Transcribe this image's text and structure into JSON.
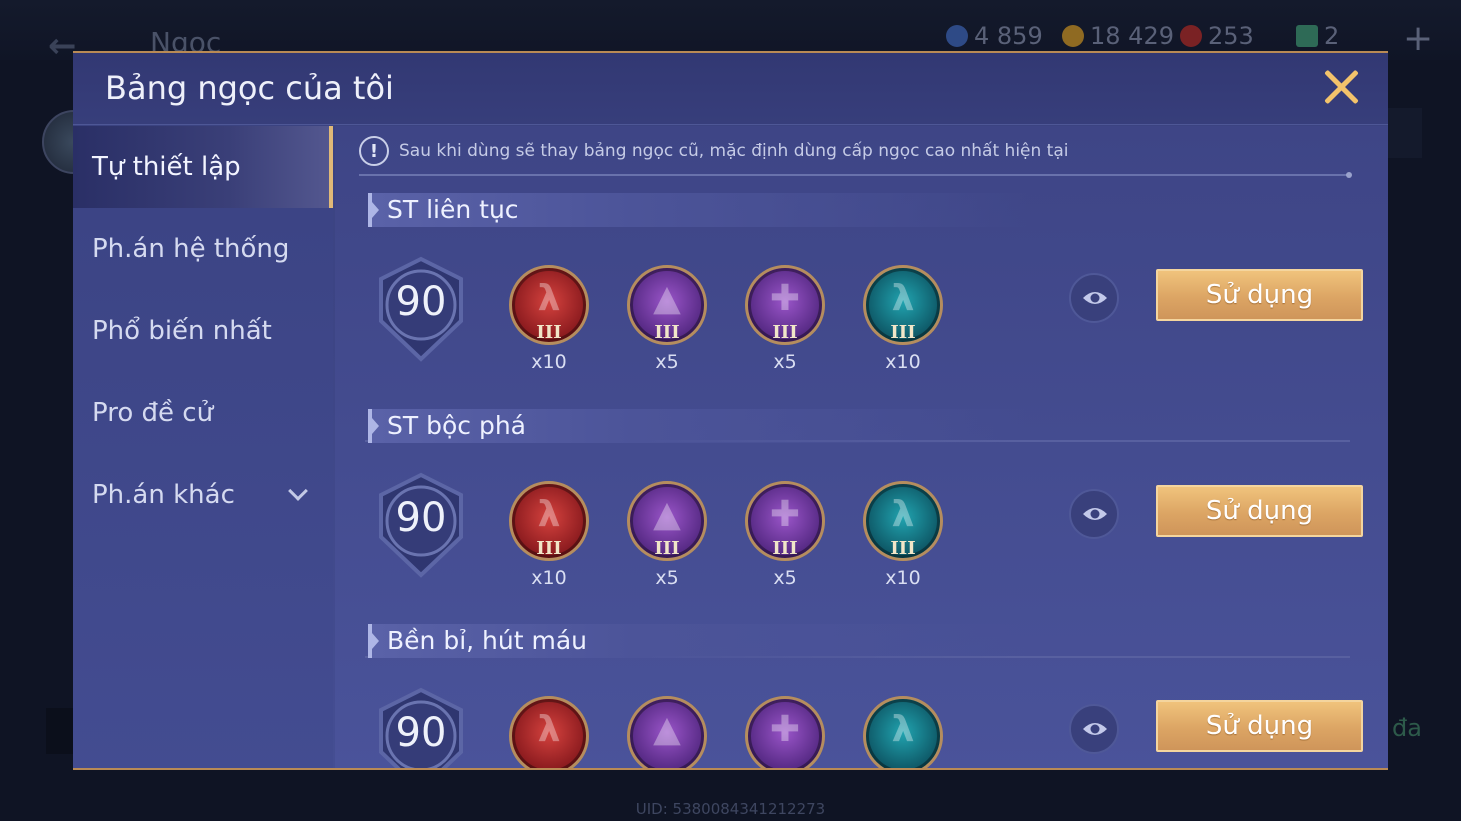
{
  "background": {
    "title": "Ngọc",
    "currencies": [
      {
        "icon": "blue-gem-icon",
        "value": "4 859",
        "color": "#3a5aa0"
      },
      {
        "icon": "gold-coin-icon",
        "value": "18 429",
        "color": "#b88a2a"
      },
      {
        "icon": "red-gem-icon",
        "value": "253",
        "color": "#9a2a2a"
      },
      {
        "icon": "card-icon",
        "value": "2",
        "color": "#3a8a6a"
      }
    ],
    "uid": "UID: 5380084341212273",
    "right_text": "đa"
  },
  "modal": {
    "title": "Bảng ngọc của tôi"
  },
  "sidebar": {
    "items": [
      {
        "label": "Tự thiết lập",
        "active": true
      },
      {
        "label": "Ph.án hệ thống",
        "active": false
      },
      {
        "label": "Phổ biến nhất",
        "active": false
      },
      {
        "label": "Pro đề cử",
        "active": false
      },
      {
        "label": "Ph.án khác",
        "active": false,
        "has_dropdown": true
      }
    ]
  },
  "notice": {
    "icon": "exclamation-icon",
    "text": "Sau khi dùng sẽ thay bảng ngọc cũ, mặc định dùng cấp ngọc cao nhất hiện tại"
  },
  "presets": [
    {
      "name": "ST liên tục",
      "level": "90",
      "gems": [
        {
          "color": "red",
          "tier": "III",
          "count": "x10"
        },
        {
          "color": "purple",
          "tier": "III",
          "count": "x5"
        },
        {
          "color": "purple",
          "tier": "III",
          "count": "x5"
        },
        {
          "color": "teal",
          "tier": "III",
          "count": "x10"
        }
      ],
      "button": "Sử dụng"
    },
    {
      "name": "ST bộc phá",
      "level": "90",
      "gems": [
        {
          "color": "red",
          "tier": "III",
          "count": "x10"
        },
        {
          "color": "purple",
          "tier": "III",
          "count": "x5"
        },
        {
          "color": "purple",
          "tier": "III",
          "count": "x5"
        },
        {
          "color": "teal",
          "tier": "III",
          "count": "x10"
        }
      ],
      "button": "Sử dụng"
    },
    {
      "name": "Bền bỉ, hút máu",
      "level": "90",
      "gems": [
        {
          "color": "red",
          "tier": "",
          "count": ""
        },
        {
          "color": "purple",
          "tier": "",
          "count": ""
        },
        {
          "color": "purple",
          "tier": "",
          "count": ""
        },
        {
          "color": "teal",
          "tier": "",
          "count": ""
        }
      ],
      "button": "Sử dụng"
    }
  ]
}
